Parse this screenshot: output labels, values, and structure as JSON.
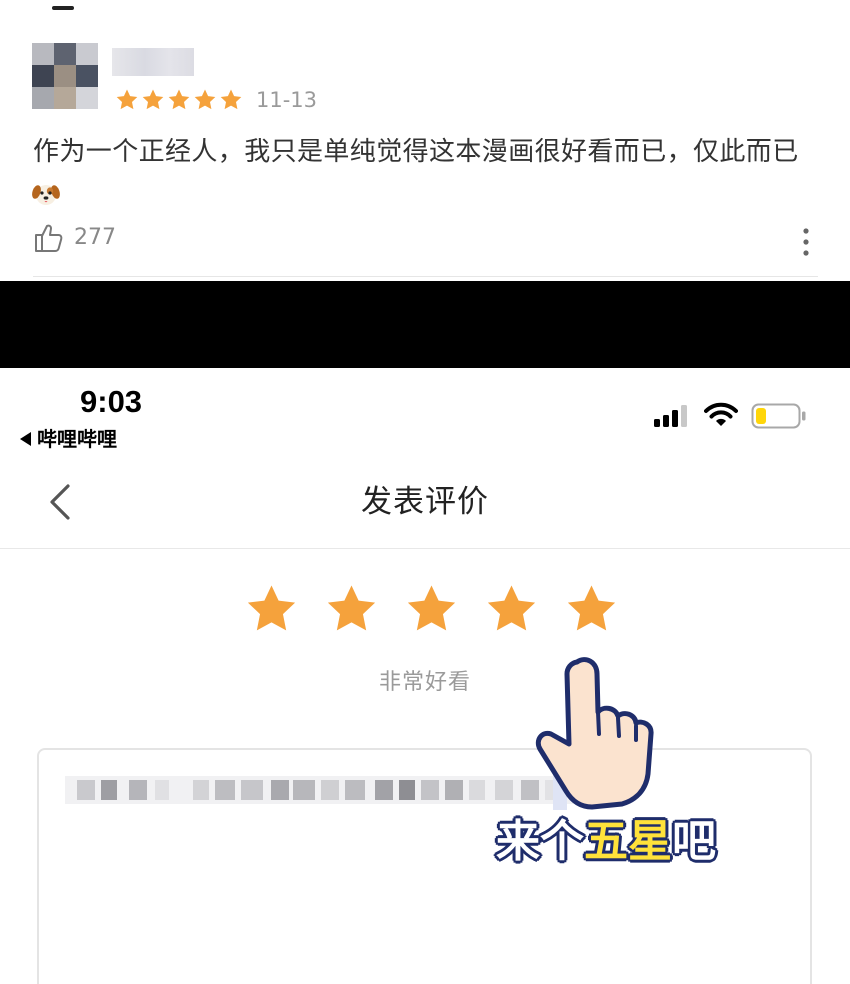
{
  "review": {
    "rating_stars": 5,
    "date": "11-13",
    "text": "作为一个正经人，我只是单纯觉得这本漫画很好看而已，仅此而已",
    "emoji": "dog-face",
    "like_count": "277"
  },
  "status_bar": {
    "time": "9:03",
    "back_app": "哔哩哔哩"
  },
  "nav": {
    "title": "发表评价"
  },
  "rating": {
    "stars": 5,
    "label": "非常好看"
  },
  "overlay": {
    "cta_prefix": "来个",
    "cta_highlight": "五星",
    "cta_suffix": "吧"
  },
  "colors": {
    "star": "#f5a23c",
    "cta_highlight": "#ffe23a",
    "cta_outline": "#1f2d6b",
    "battery_fill": "#ffd60a"
  }
}
